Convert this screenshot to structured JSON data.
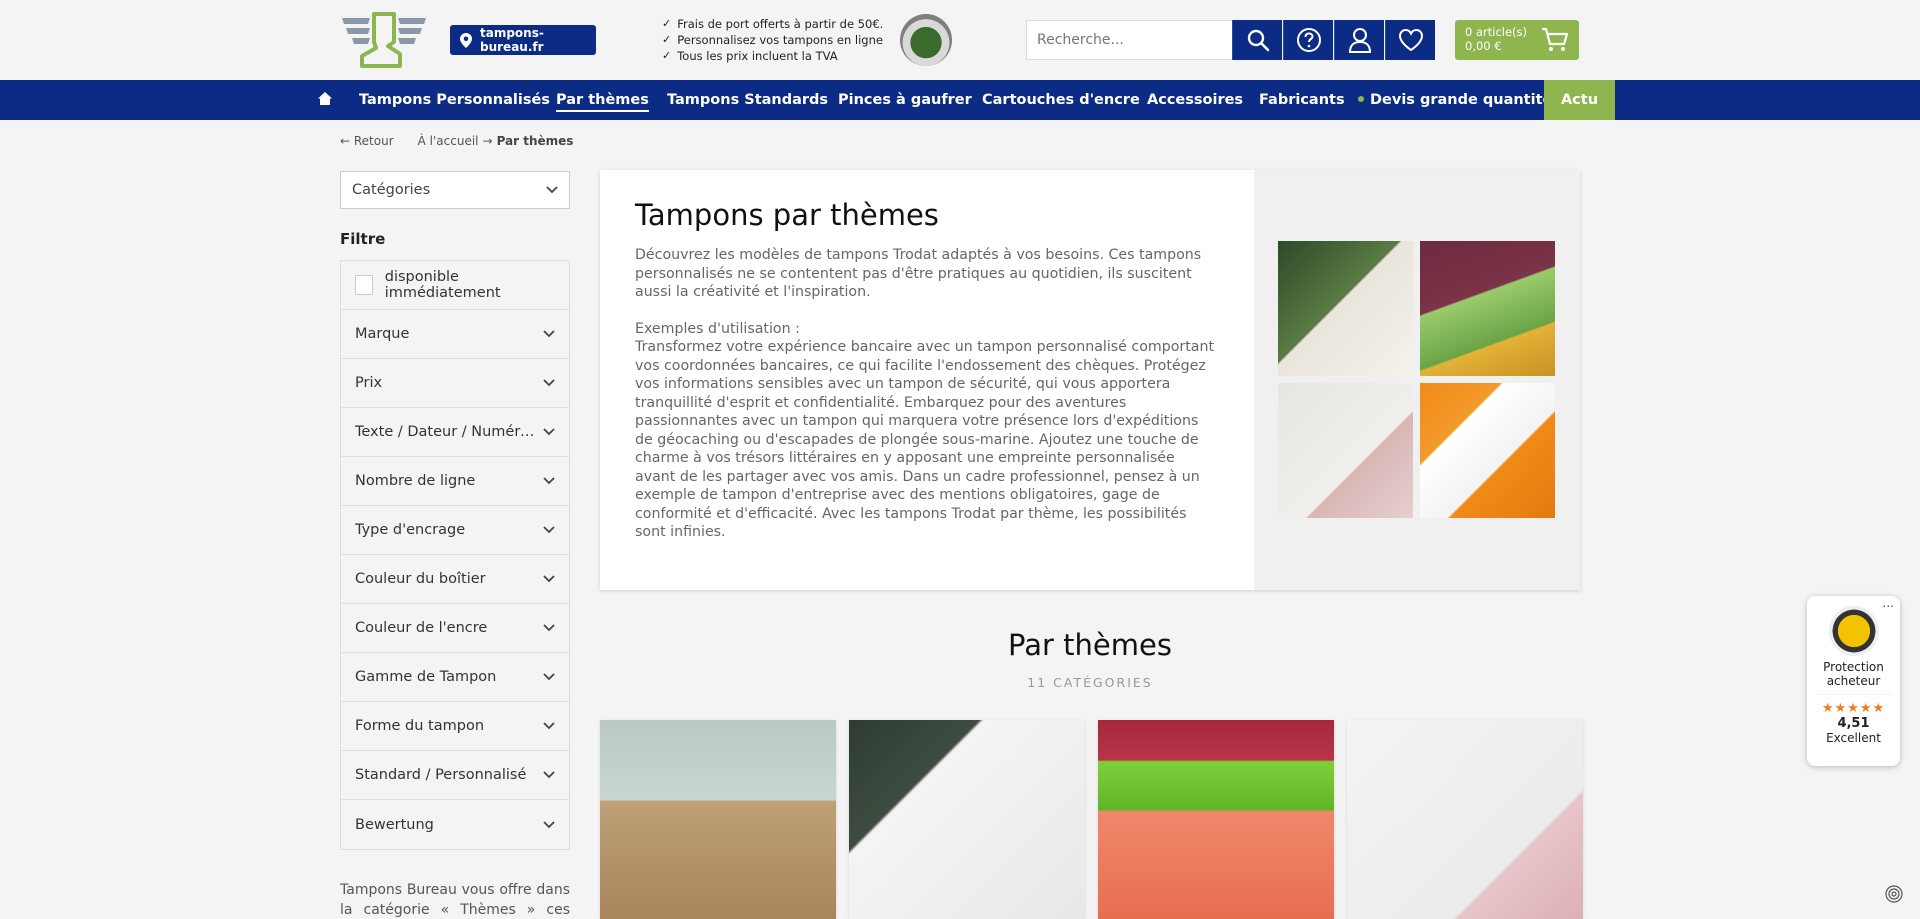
{
  "header": {
    "domain_label": "tampons-bureau.fr",
    "benefits": [
      "Frais de port offerts à partir de 50€.",
      "Personnalisez vos tampons en ligne",
      "Tous les prix incluent la TVA"
    ],
    "search_placeholder": "Recherche...",
    "cart_items": "0 article(s)",
    "cart_total": "0,00 €",
    "icons": [
      "search-icon",
      "help-icon",
      "user-icon",
      "heart-icon",
      "cart-icon"
    ]
  },
  "nav": {
    "items": [
      "Tampons Personnalisés",
      "Par thèmes",
      "Tampons Standards",
      "Pinces à gaufrer",
      "Cartouches d'encre",
      "Accessoires",
      "Fabricants",
      "Devis grande quantité"
    ],
    "actu": "Actu"
  },
  "breadcrumb": {
    "back": "← Retour",
    "home": "À l'accueil",
    "arrow": "→",
    "current": "Par thèmes"
  },
  "sidebar": {
    "categories_label": "Catégories",
    "filter_title": "Filtre",
    "available_label": "disponible immédiatement",
    "filters": [
      "Marque",
      "Prix",
      "Texte / Dateur / Numéroteur",
      "Nombre de ligne",
      "Type d'encrage",
      "Couleur du boîtier",
      "Couleur de l'encre",
      "Gamme de Tampon",
      "Forme du tampon",
      "Standard / Personnalisé",
      "Bewertung"
    ],
    "footer_text": "Tampons Bureau vous offre dans la catégorie « Thèmes » ces tampons"
  },
  "intro": {
    "title": "Tampons par thèmes",
    "para1": "Découvrez les modèles de tampons Trodat adaptés à vos besoins. Ces tampons personnalisés ne se contentent pas d'être pratiques au quotidien, ils suscitent aussi la créativité et l'inspiration.",
    "para2_heading": "Exemples d'utilisation :",
    "para2": "Transformez votre expérience bancaire avec un tampon personnalisé comportant vos coordonnées bancaires, ce qui facilite l'endossement des chèques. Protégez vos informations sensibles avec un tampon de sécurité, qui vous apportera tranquillité d'esprit et confidentialité. Embarquez pour des aventures passionnantes avec un tampon qui marquera votre présence lors d'expéditions de géocaching ou d'escapades de plongée sous-marine. Ajoutez une touche de charme à vos trésors littéraires en y apposant une empreinte personnalisée avant de les partager avec vos amis. Dans un cadre professionnel, pensez à un exemple de tampon d'entreprise avec des mentions obligatoires, gage de conformité et d'efficacité. Avec les tampons Trodat par thème, les possibilités sont infinies."
  },
  "section": {
    "title": "Par thèmes",
    "subtitle": "11 CATÉGORIES"
  },
  "trust": {
    "label1": "Protection",
    "label2": "acheteur",
    "score": "4,51",
    "rating_word": "Excellent",
    "more": "..."
  },
  "colors": {
    "brand_blue": "#0b2b84",
    "accent_green": "#8fb64e"
  }
}
